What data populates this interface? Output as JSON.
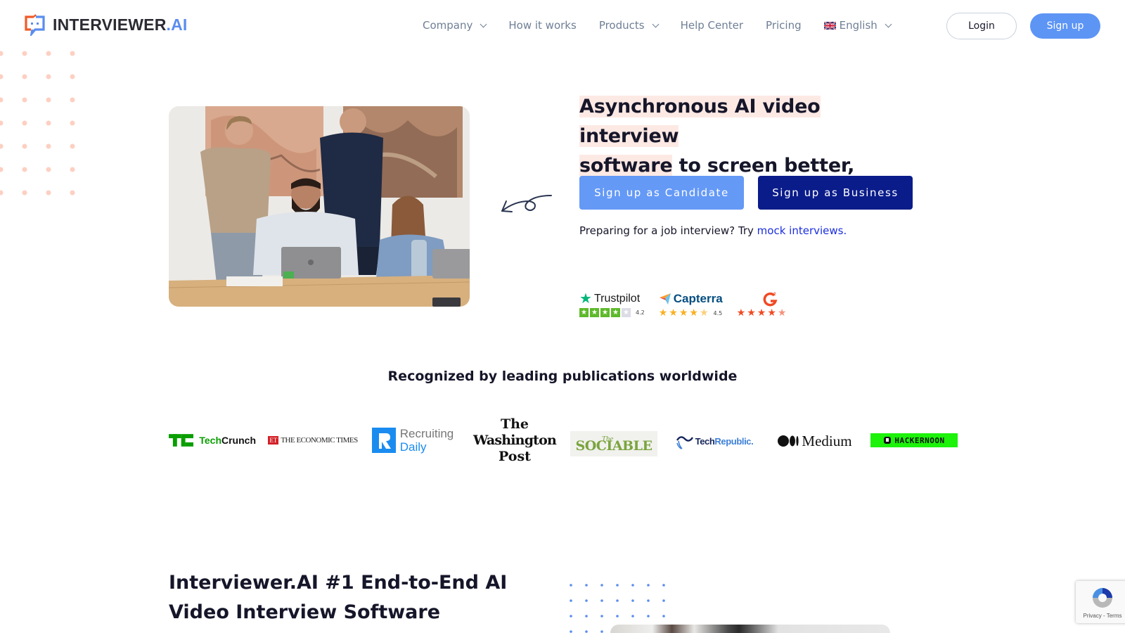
{
  "header": {
    "logo": {
      "main": "INTERVIEWER",
      "accent": ".AI"
    },
    "nav": [
      {
        "label": "Company",
        "dropdown": true
      },
      {
        "label": "How it works",
        "dropdown": false
      },
      {
        "label": "Products",
        "dropdown": true
      },
      {
        "label": "Help Center",
        "dropdown": false
      },
      {
        "label": "Pricing",
        "dropdown": false
      },
      {
        "label": "English",
        "dropdown": true,
        "icon": "uk-flag-icon"
      }
    ],
    "login_label": "Login",
    "signup_label": "Sign up"
  },
  "hero": {
    "title_highlight_line1": "Asynchronous AI video interview",
    "title_highlight_line2": "software",
    "title_rest": " to screen better, faster.",
    "candidate_button": "Sign up as Candidate",
    "business_button": "Sign up as Business",
    "mock_prefix": "Preparing for a job interview? Try ",
    "mock_link": "mock interviews.",
    "photo_alt": "Team smiling at a laptop"
  },
  "ratings": [
    {
      "name": "Trustpilot",
      "score": "4.2",
      "stars": 4
    },
    {
      "name": "Capterra",
      "score": "4.5",
      "stars": 4.5
    },
    {
      "name": "G2",
      "score": "",
      "stars": 4.5
    }
  ],
  "publications": {
    "title": "Recognized by leading publications worldwide",
    "items": [
      {
        "name": "TechCrunch",
        "prefix": "Tech",
        "suffix": "Crunch"
      },
      {
        "name": "The Economic Times",
        "badge": "ET",
        "text": "THE ECONOMIC TIMES"
      },
      {
        "name": "Recruiting Daily",
        "line1": "Recruiting",
        "line2": "Daily"
      },
      {
        "name": "The Washington Post",
        "line1": "The",
        "line2": "Washington",
        "line3": "Post"
      },
      {
        "name": "The Sociable",
        "small": "The",
        "text": "SOCIABLE"
      },
      {
        "name": "TechRepublic",
        "prefix": "Tech",
        "suffix": "Republic."
      },
      {
        "name": "Medium",
        "text": "Medium"
      },
      {
        "name": "Hackernoon",
        "text": "HACKERNOON"
      }
    ]
  },
  "section2": {
    "title_line1": "Interviewer.AI #1 End-to-End AI",
    "title_line2": "Video Interview Software"
  },
  "recaptcha": {
    "text": "Privacy - Terms"
  },
  "colors": {
    "brand_blue": "#5d95f5",
    "brand_navy": "#0a1c8a",
    "brand_orange": "#f05a28",
    "highlight": "#fde9e4",
    "link": "#1a2ee0"
  }
}
